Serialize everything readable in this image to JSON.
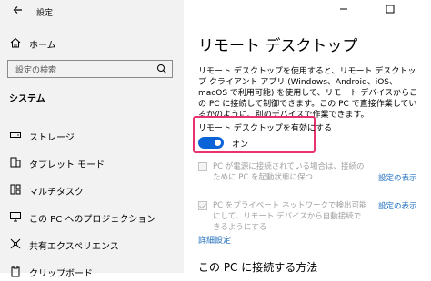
{
  "window": {
    "title": "設定"
  },
  "sidebar": {
    "home_label": "ホーム",
    "search_placeholder": "設定の検索",
    "section_title": "システム",
    "items": [
      {
        "label": "ストレージ",
        "icon": "storage-icon"
      },
      {
        "label": "タブレット モード",
        "icon": "tablet-mode-icon"
      },
      {
        "label": "マルチタスク",
        "icon": "multitasking-icon"
      },
      {
        "label": "この PC へのプロジェクション",
        "icon": "projection-icon"
      },
      {
        "label": "共有エクスペリエンス",
        "icon": "shared-experiences-icon"
      },
      {
        "label": "クリップボード",
        "icon": "clipboard-icon"
      }
    ]
  },
  "main": {
    "page_title": "リモート デスクトップ",
    "description": "リモート デスクトップを使用すると、リモート デスクトップ クライアント アプリ (Windows、Android、iOS、macOS で利用可能) を使用して、リモート デバイスからこの PC に接続して制御できます。この PC で直接作業しているかのように、別のデバイスで作業できます。",
    "toggle": {
      "label": "リモート デスクトップを有効にする",
      "state": "オン",
      "on": true
    },
    "options": [
      {
        "text": "PC が電源に接続されている場合は、接続のために PC を起動状態に保つ",
        "link": "設定の表示",
        "checked": false
      },
      {
        "text": "PC をプライベート ネットワークで検出可能にして、リモート デバイスから自動接続できるようにする",
        "link": "設定の表示",
        "checked": true
      }
    ],
    "advanced_link": "詳細設定",
    "subheading": "この PC に接続する方法"
  },
  "colors": {
    "accent": "#0a64d8",
    "highlight": "#e8336f",
    "link": "#1f6fbf"
  }
}
